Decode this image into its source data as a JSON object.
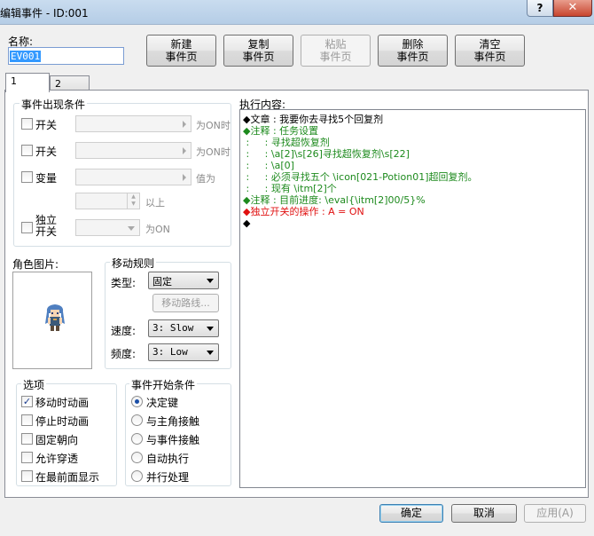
{
  "window": {
    "title": "编辑事件 - ID:001",
    "help": "?",
    "close": "✕"
  },
  "name": {
    "label": "名称:",
    "value": "EV001"
  },
  "toolbar": [
    {
      "line1": "新建",
      "line2": "事件页",
      "enabled": true
    },
    {
      "line1": "复制",
      "line2": "事件页",
      "enabled": true
    },
    {
      "line1": "粘贴",
      "line2": "事件页",
      "enabled": false
    },
    {
      "line1": "删除",
      "line2": "事件页",
      "enabled": true
    },
    {
      "line1": "清空",
      "line2": "事件页",
      "enabled": true
    }
  ],
  "tabs": [
    "1",
    "2"
  ],
  "conditions": {
    "title": "事件出现条件",
    "switch1": {
      "label": "开关",
      "suffix": "为ON时"
    },
    "switch2": {
      "label": "开关",
      "suffix": "为ON时"
    },
    "variable": {
      "label": "变量",
      "suffix": "值为",
      "suffix2": "以上"
    },
    "self_switch": {
      "label1": "独立",
      "label2": "开关",
      "suffix": "为ON"
    }
  },
  "graphic": {
    "label": "角色图片:",
    "icon": "character-sprite"
  },
  "movement": {
    "title": "移动规则",
    "type_label": "类型:",
    "type_value": "固定",
    "route_button": "移动路线...",
    "speed_label": "速度:",
    "speed_value": "3: Slow",
    "freq_label": "频度:",
    "freq_value": "3: Low"
  },
  "options": {
    "title": "选项",
    "items": [
      {
        "label": "移动时动画",
        "checked": true
      },
      {
        "label": "停止时动画",
        "checked": false
      },
      {
        "label": "固定朝向",
        "checked": false
      },
      {
        "label": "允许穿透",
        "checked": false
      },
      {
        "label": "在最前面显示",
        "checked": false
      }
    ]
  },
  "trigger": {
    "title": "事件开始条件",
    "items": [
      {
        "label": "决定键",
        "selected": true
      },
      {
        "label": "与主角接触",
        "selected": false
      },
      {
        "label": "与事件接触",
        "selected": false
      },
      {
        "label": "自动执行",
        "selected": false
      },
      {
        "label": "并行处理",
        "selected": false
      }
    ]
  },
  "contents": {
    "label": "执行内容:",
    "lines": [
      {
        "text": "◆文章 : 我要你去寻找5个回复剂",
        "color": "#000000"
      },
      {
        "text": "◆注释 : 任务设置",
        "color": "#1d8a1d"
      },
      {
        "text": " :     : 寻找超恢复剂",
        "color": "#1d8a1d"
      },
      {
        "text": " :     : \\a[2]\\s[26]寻找超恢复剂\\s[22]",
        "color": "#1d8a1d"
      },
      {
        "text": " :     : \\a[0]",
        "color": "#1d8a1d"
      },
      {
        "text": " :     : 必须寻找五个 \\icon[021-Potion01]超回复剂。",
        "color": "#1d8a1d"
      },
      {
        "text": " :     : 现有 \\itm[2]个",
        "color": "#1d8a1d"
      },
      {
        "text": "◆注释 : 目前进度: \\eval{\\itm[2]00/5}%",
        "color": "#1d8a1d"
      },
      {
        "text": "◆独立开关的操作 : A = ON",
        "color": "#e01010"
      },
      {
        "text": "◆",
        "color": "#000000"
      }
    ]
  },
  "footer": {
    "ok": "确定",
    "cancel": "取消",
    "apply": "应用(A)"
  }
}
